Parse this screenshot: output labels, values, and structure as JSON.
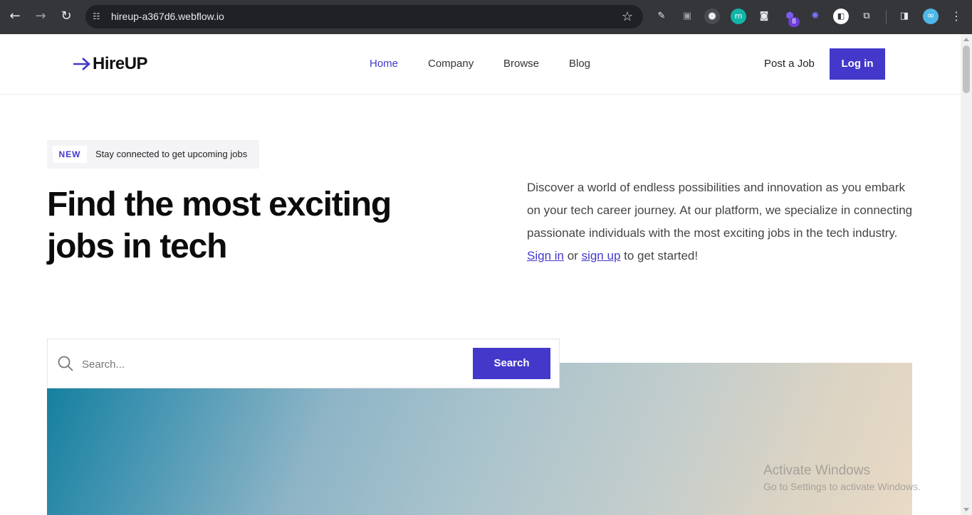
{
  "browser": {
    "url": "hireup-a367d6.webflow.io",
    "extension_badge": "8",
    "icons": [
      "back-icon",
      "forward-icon",
      "reload-icon",
      "site-settings-icon",
      "bookmark-star-icon",
      "eyedropper-icon",
      "camera-icon",
      "extension-icon",
      "puzzle-icon",
      "side-panel-icon",
      "profile-icon",
      "menu-icon"
    ]
  },
  "nav": {
    "brand": "HireUP",
    "links": [
      "Home",
      "Company",
      "Browse",
      "Blog"
    ],
    "post_job": "Post a Job",
    "login": "Log in"
  },
  "hero": {
    "badge": "NEW",
    "tagline": "Stay connected to get upcoming jobs",
    "title": "Find the most exciting jobs in tech",
    "desc_pre": "Discover a world of endless possibilities and innovation as you embark on your tech career journey. At our platform, we specialize in connecting passionate individuals with the most exciting jobs in the tech industry.",
    "sign_in": "Sign in",
    "or": "or",
    "sign_up": "sign up",
    "desc_post": "to get started!"
  },
  "search": {
    "placeholder": "Search...",
    "button": "Search"
  },
  "watermark": {
    "line1": "Activate Windows",
    "line2": "Go to Settings to activate Windows."
  },
  "colors": {
    "accent": "#4338ca",
    "chrome_bg": "#35363a",
    "text_dark": "#0c0c0c"
  }
}
